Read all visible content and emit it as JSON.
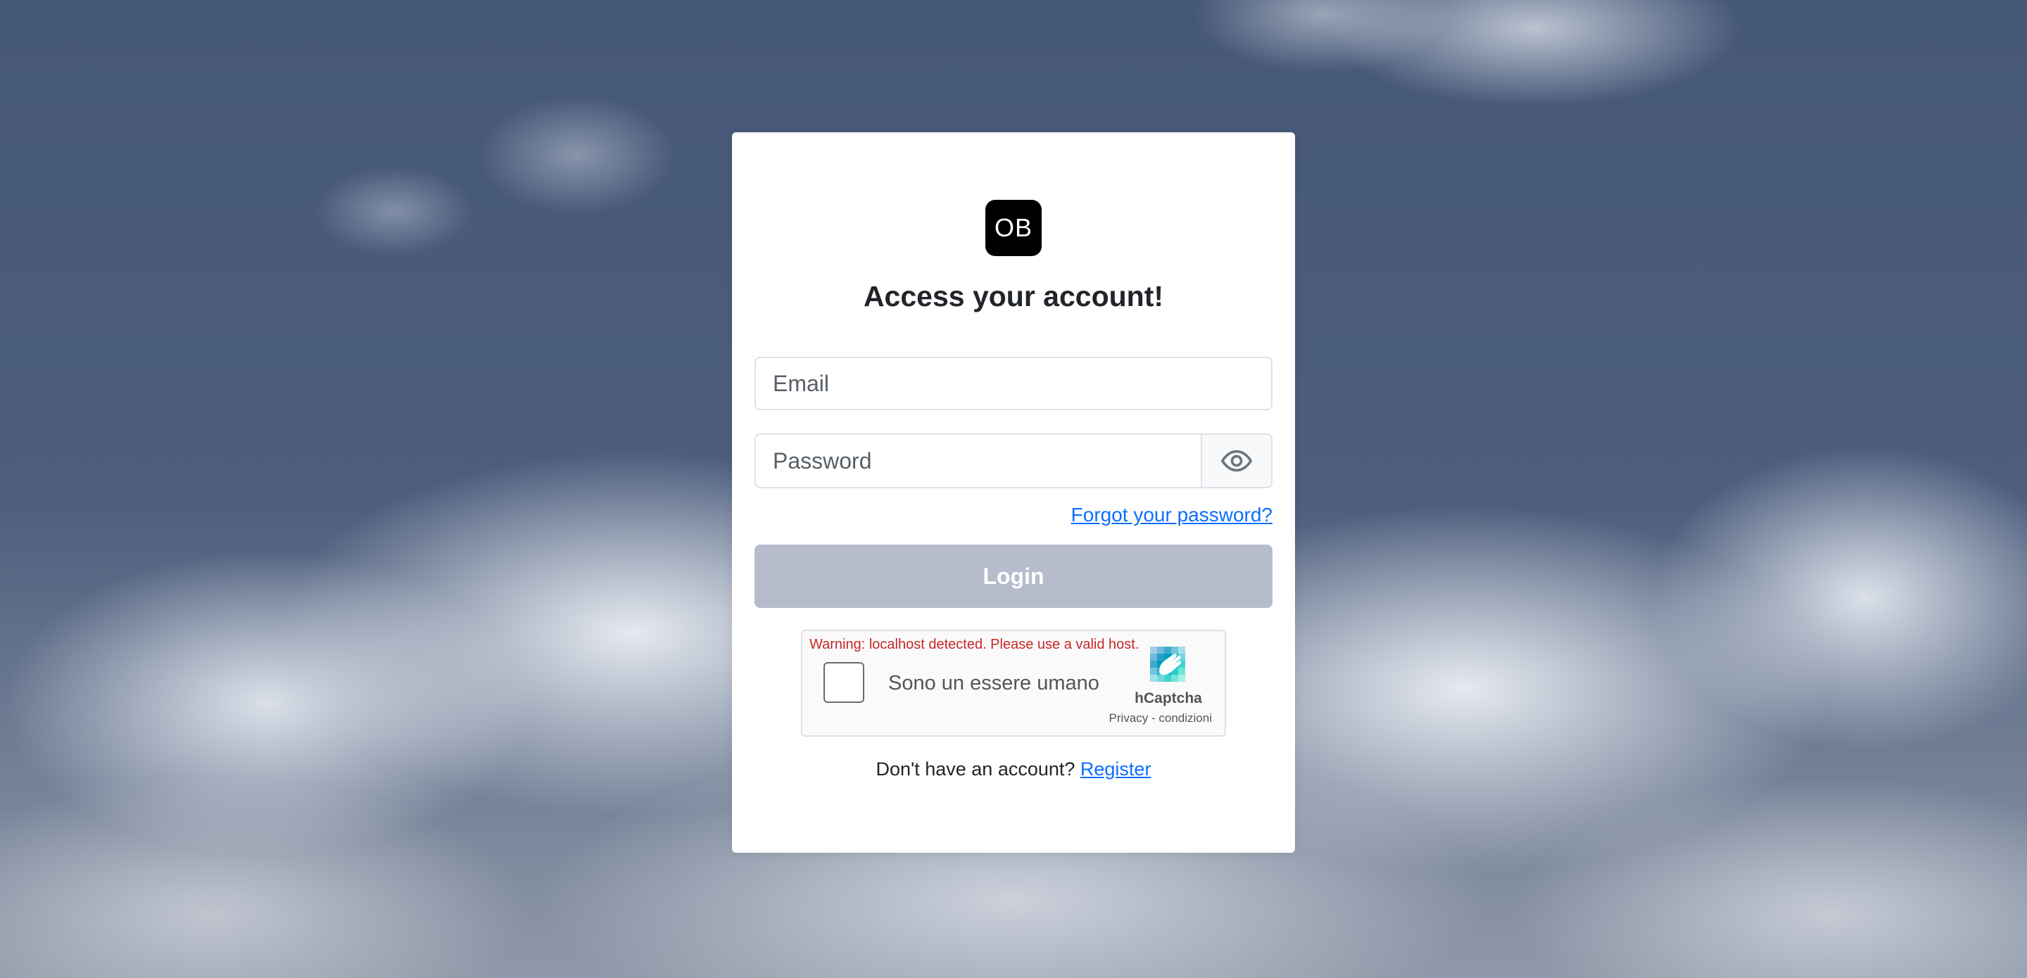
{
  "logo": {
    "text": "OB"
  },
  "heading": "Access your account!",
  "form": {
    "email_placeholder": "Email",
    "email_value": "",
    "password_placeholder": "Password",
    "password_value": "",
    "toggle_icon": "eye-icon",
    "forgot_password": "Forgot your password?",
    "login_label": "Login"
  },
  "captcha": {
    "warning": "Warning: localhost detected. Please use a valid host.",
    "checkbox_label": "Sono un essere umano",
    "brand": "hCaptcha",
    "privacy": "Privacy",
    "separator": " - ",
    "terms": "condizioni",
    "logo_icon": "hcaptcha-logo-icon"
  },
  "register": {
    "prompt": "Don't have an account? ",
    "link": "Register"
  },
  "colors": {
    "primary_link": "#0d6efd",
    "login_disabled": "#b7bccc",
    "warning": "#c62828",
    "logo_bg": "#000000"
  }
}
